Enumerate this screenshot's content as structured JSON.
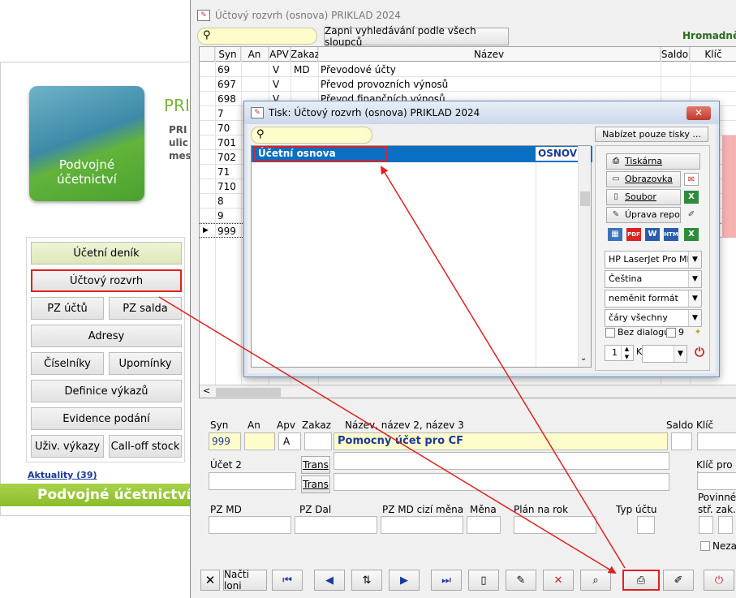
{
  "background_app": {
    "heading_partial": "PRI",
    "text_partial": [
      "PRI",
      "ulic",
      "mes"
    ],
    "logo_lines": [
      "Podvojné",
      "účetnictví"
    ],
    "menu_buttons": [
      "Účetní deník",
      "Účtový rozvrh",
      "PZ účtů",
      "PZ salda",
      "Adresy",
      "Číselníky",
      "Upomínky",
      "Definice výkazů",
      "Evidence podání",
      "Uživ. výkazy",
      "Call-off stock"
    ],
    "news_link": "Aktuality (39)",
    "footer_title": "Podvojné účetnictví"
  },
  "main_window": {
    "title": "Účtový rozvrh (osnova) PRIKLAD 2024",
    "search_all_button": "Zapni vyhledávání podle všech sloupců",
    "bulk_label": "Hromadně",
    "grid_headers": [
      "Syn",
      "An",
      "APV",
      "Zakaz",
      "Název",
      "Saldo",
      "Klíč"
    ],
    "grid_rows": [
      {
        "syn": "69",
        "apv": "V",
        "zakaz": "MD",
        "nazev": "Převodové účty"
      },
      {
        "syn": "697",
        "apv": "V",
        "zakaz": "",
        "nazev": "Převod provozních výnosů"
      },
      {
        "syn": "698",
        "apv": "V",
        "zakaz": "",
        "nazev": "Převod finančních výnosů"
      },
      {
        "syn": "7",
        "apv": "",
        "zakaz": "",
        "nazev": ""
      },
      {
        "syn": "70",
        "apv": "",
        "zakaz": "",
        "nazev": ""
      },
      {
        "syn": "701",
        "apv": "",
        "zakaz": "",
        "nazev": ""
      },
      {
        "syn": "702",
        "apv": "",
        "zakaz": "",
        "nazev": ""
      },
      {
        "syn": "71",
        "apv": "",
        "zakaz": "",
        "nazev": ""
      },
      {
        "syn": "710",
        "apv": "",
        "zakaz": "",
        "nazev": ""
      },
      {
        "syn": "8",
        "apv": "",
        "zakaz": "",
        "nazev": ""
      },
      {
        "syn": "9",
        "apv": "",
        "zakaz": "",
        "nazev": ""
      },
      {
        "syn": "999",
        "apv": "",
        "zakaz": "",
        "nazev": ""
      }
    ],
    "detail": {
      "labels": {
        "syn": "Syn",
        "an": "An",
        "apv": "Apv",
        "zakaz": "Zakaz",
        "nazev": "Název, název 2, název 3",
        "saldo": "Saldo",
        "klic": "Klíč rozv",
        "ucet2": "Účet 2",
        "trans1": "Trans",
        "trans2": "Trans",
        "klic_pro": "Klíč pro l",
        "pz_md": "PZ MD",
        "pz_dal": "PZ Dal",
        "pz_md_cizi": "PZ MD cizí měna",
        "mena": "Měna",
        "plan": "Plán na rok",
        "typ_uctu": "Typ účtu",
        "povinne": "Povinné",
        "str_zak": "stř. zak.",
        "nezal": "Nezal"
      },
      "values": {
        "syn": "999",
        "apv": "A",
        "nazev": "Pomocný účet pro CF"
      }
    },
    "toolbar": {
      "close": "✕",
      "load_last_year": "Načti loni"
    }
  },
  "print_dialog": {
    "title": "Tisk: Účtový rozvrh (osnova) PRIKLAD 2024",
    "offer_button": "Nabízet pouze tisky ...",
    "list_item": "Účetní osnova",
    "list_item_code": "OSNOV",
    "buttons": {
      "printer": "Tiskárna",
      "screen": "Obrazovka",
      "file": "Soubor",
      "edit_report": "Úprava repor"
    },
    "printer_select": "HP LaserJet Pro MFF",
    "language_select": "Čeština",
    "format_select": "neměnit formát",
    "lines_select": "čáry všechny",
    "no_dialog_label": "Bez dialogu",
    "no_dialog_num": "9",
    "copies": "1",
    "copies_suffix": "K"
  },
  "colors": {
    "accent_red": "#e02020",
    "selection_blue": "#0a6fc2",
    "input_yellow": "#fffccc",
    "logo_green": "#4aa22f"
  }
}
